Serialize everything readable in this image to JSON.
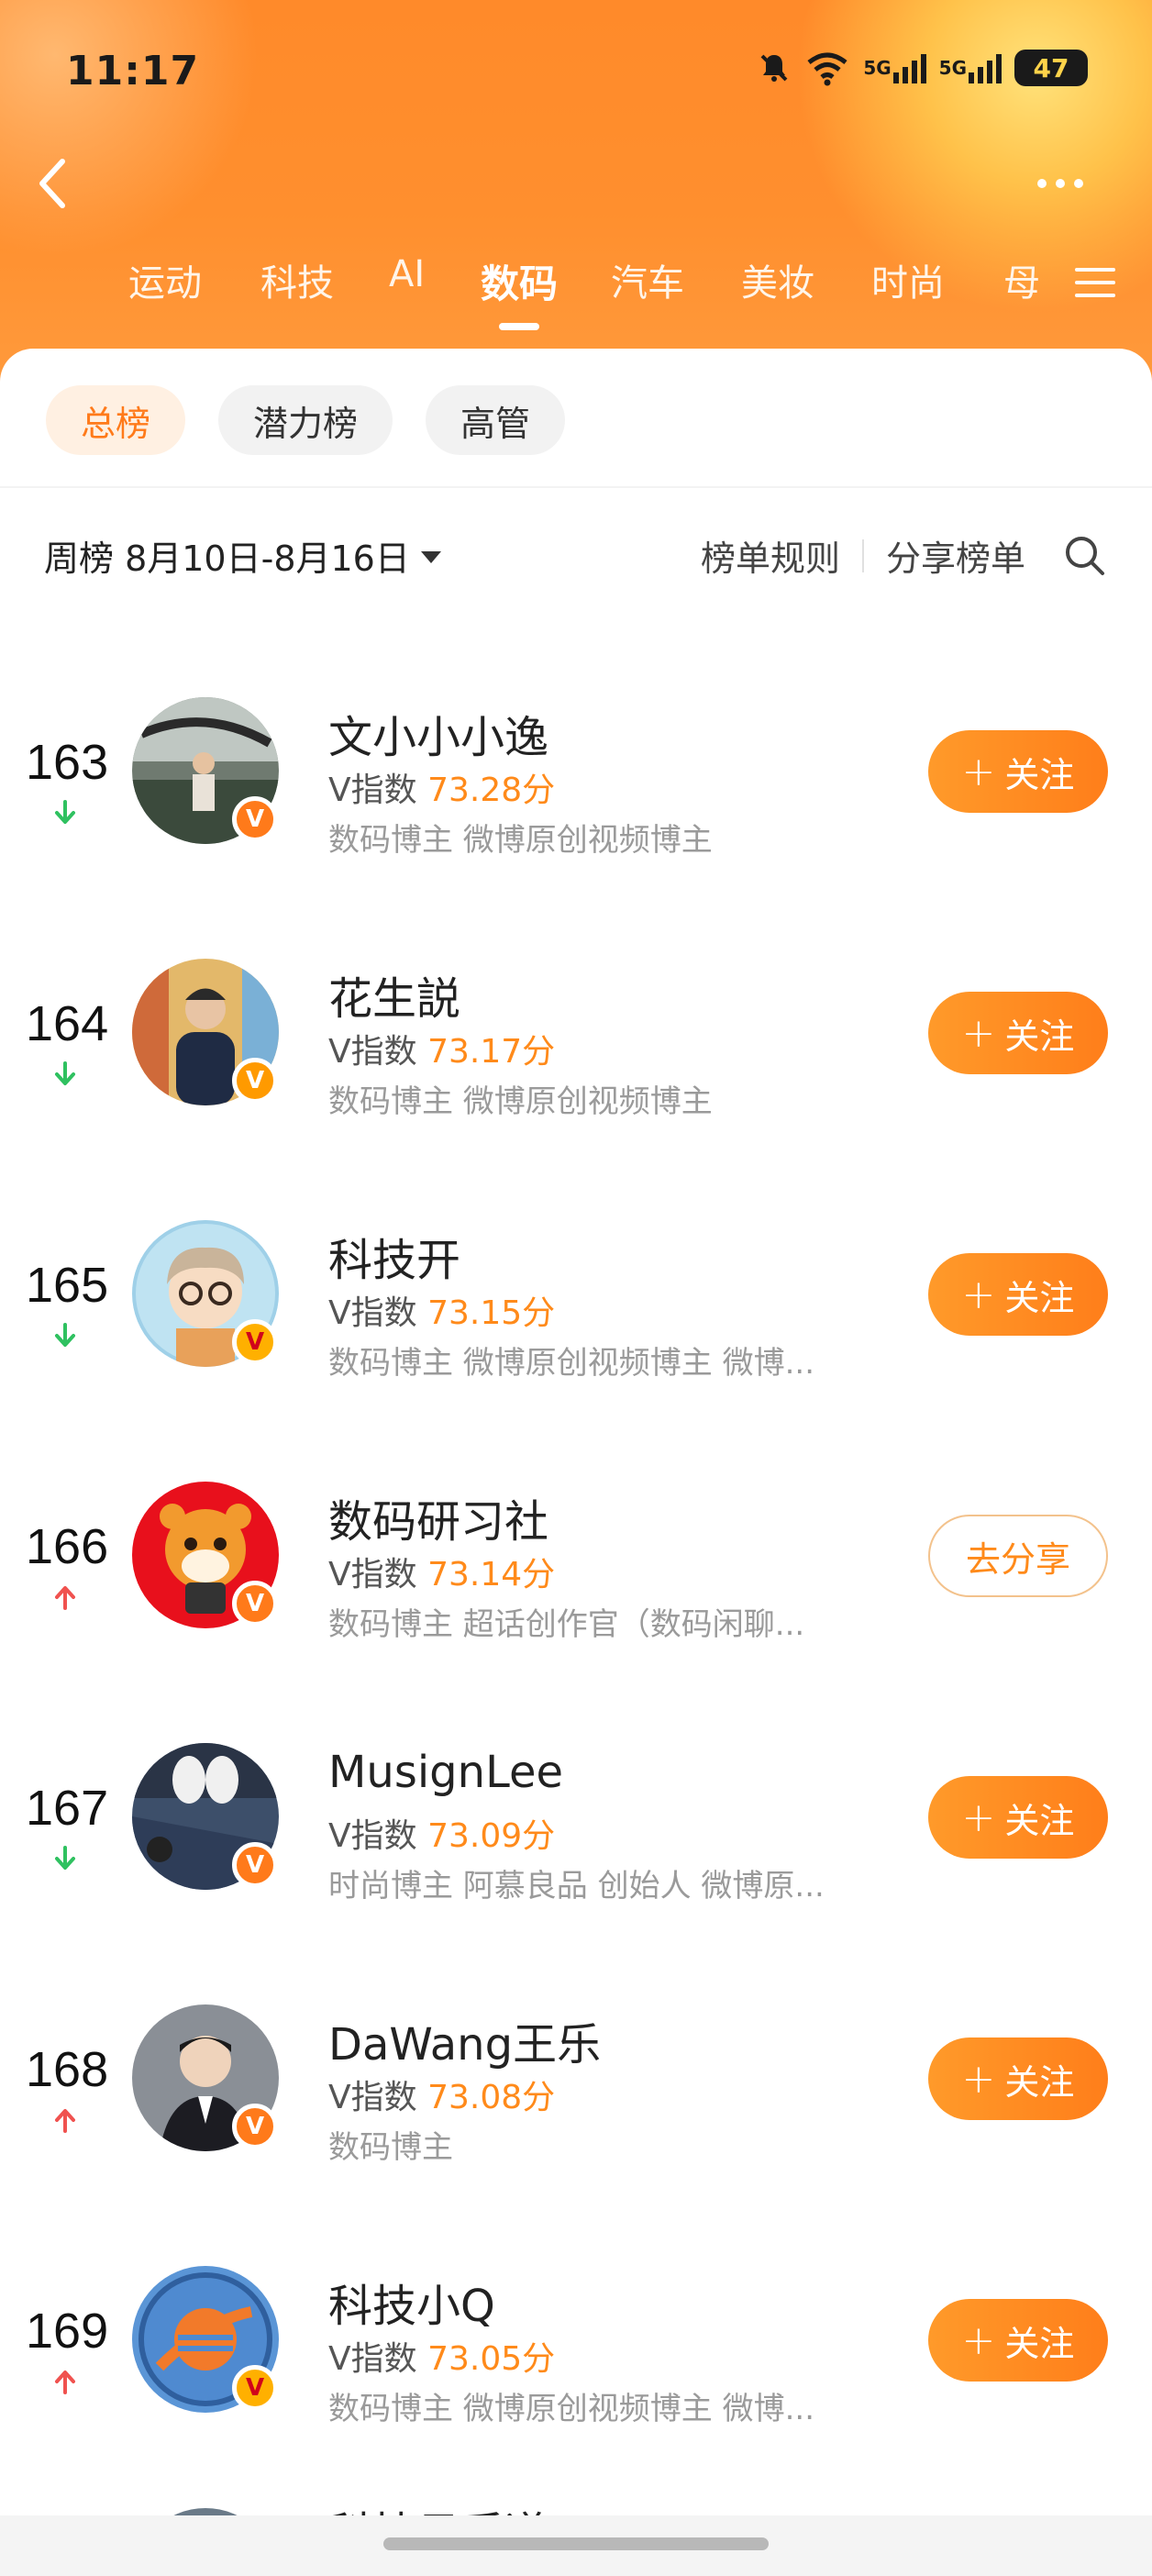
{
  "status_bar": {
    "time": "11:17",
    "network_1": "5G",
    "network_2": "5G",
    "wifi_label": "7",
    "battery": "47"
  },
  "nav": {
    "tabs": [
      {
        "label": "运动"
      },
      {
        "label": "科技"
      },
      {
        "label": "AI"
      },
      {
        "label": "数码"
      },
      {
        "label": "汽车"
      },
      {
        "label": "美妆"
      },
      {
        "label": "时尚"
      },
      {
        "label": "母"
      }
    ],
    "active_tab": "数码"
  },
  "sub_tabs": [
    {
      "label": "总榜"
    },
    {
      "label": "潜力榜"
    },
    {
      "label": "高管"
    }
  ],
  "period": {
    "label": "周榜 8月10日-8月16日",
    "rules_link": "榜单规则",
    "share_link": "分享榜单"
  },
  "list": [
    {
      "rank": "163",
      "trend": "down",
      "name": "文小小小逸",
      "vindex_label": "V指数",
      "score": "73.28分",
      "desc": "数码博主 微博原创视频博主",
      "action": "关注"
    },
    {
      "rank": "164",
      "trend": "down",
      "name": "花生説",
      "vindex_label": "V指数",
      "score": "73.17分",
      "desc": "数码博主 微博原创视频博主",
      "action": "关注"
    },
    {
      "rank": "165",
      "trend": "down",
      "name": "科技开",
      "vindex_label": "V指数",
      "score": "73.15分",
      "desc": "数码博主 微博原创视频博主 微博...",
      "action": "关注"
    },
    {
      "rank": "166",
      "trend": "up",
      "name": "数码研习社",
      "vindex_label": "V指数",
      "score": "73.14分",
      "desc": "数码博主 超话创作官（数码闲聊...",
      "action": "去分享"
    },
    {
      "rank": "167",
      "trend": "down",
      "name": "MusignLee",
      "vindex_label": "V指数",
      "score": "73.09分",
      "desc": "时尚博主 阿慕良品 创始人 微博原...",
      "action": "关注"
    },
    {
      "rank": "168",
      "trend": "up",
      "name": "DaWang王乐",
      "vindex_label": "V指数",
      "score": "73.08分",
      "desc": "数码博主",
      "action": "关注"
    },
    {
      "rank": "169",
      "trend": "up",
      "name": "科技小Q",
      "vindex_label": "V指数",
      "score": "73.05分",
      "desc": "数码博主 微博原创视频博主 微博...",
      "action": "关注"
    }
  ],
  "peek_row_name": "科技日后道",
  "colors": {
    "accent": "#ff7e1a",
    "trend_down": "#2fc160",
    "trend_up": "#f0524f",
    "header_bg": "#ff8a2a"
  },
  "icons": {
    "back": "chevron-left-icon",
    "more": "more-dots-icon",
    "menu": "hamburger-icon",
    "search": "search-icon",
    "verified": "v-badge-icon"
  }
}
